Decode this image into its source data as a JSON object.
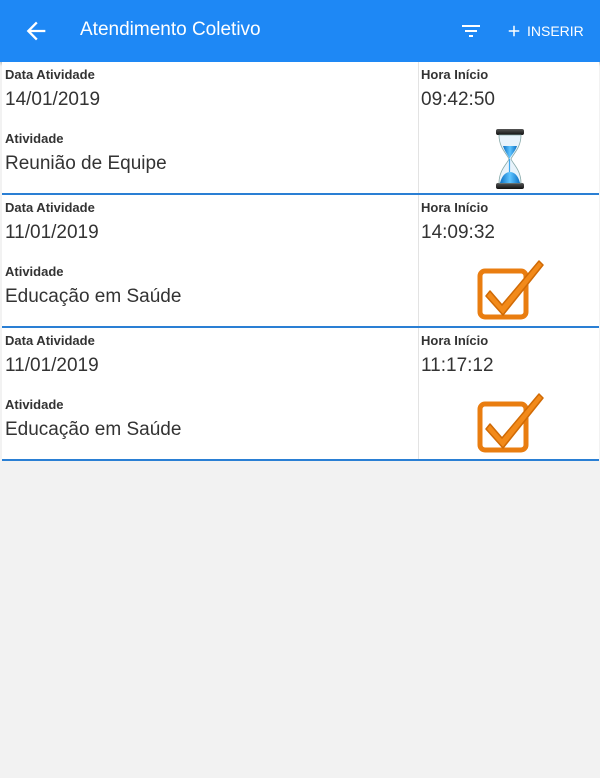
{
  "appbar": {
    "title": "Atendimento Coletivo",
    "insert_label": "INSERIR",
    "back_icon": "arrow-left-icon",
    "filter_icon": "filter-icon",
    "plus_icon": "plus-icon",
    "background": "#1e88f5"
  },
  "labels": {
    "data_atividade": "Data Atividade",
    "hora_inicio": "Hora Início",
    "atividade": "Atividade"
  },
  "items": [
    {
      "data": "14/01/2019",
      "hora": "09:42:50",
      "atividade": "Reunião de Equipe",
      "status_icon": "hourglass-icon"
    },
    {
      "data": "11/01/2019",
      "hora": "14:09:32",
      "atividade": "Educação em Saúde",
      "status_icon": "checkbox-checked-icon"
    },
    {
      "data": "11/01/2019",
      "hora": "11:17:12",
      "atividade": "Educação em Saúde",
      "status_icon": "checkbox-checked-icon"
    }
  ],
  "colors": {
    "divider": "#2a7fd4",
    "check": "#f28a1a"
  }
}
